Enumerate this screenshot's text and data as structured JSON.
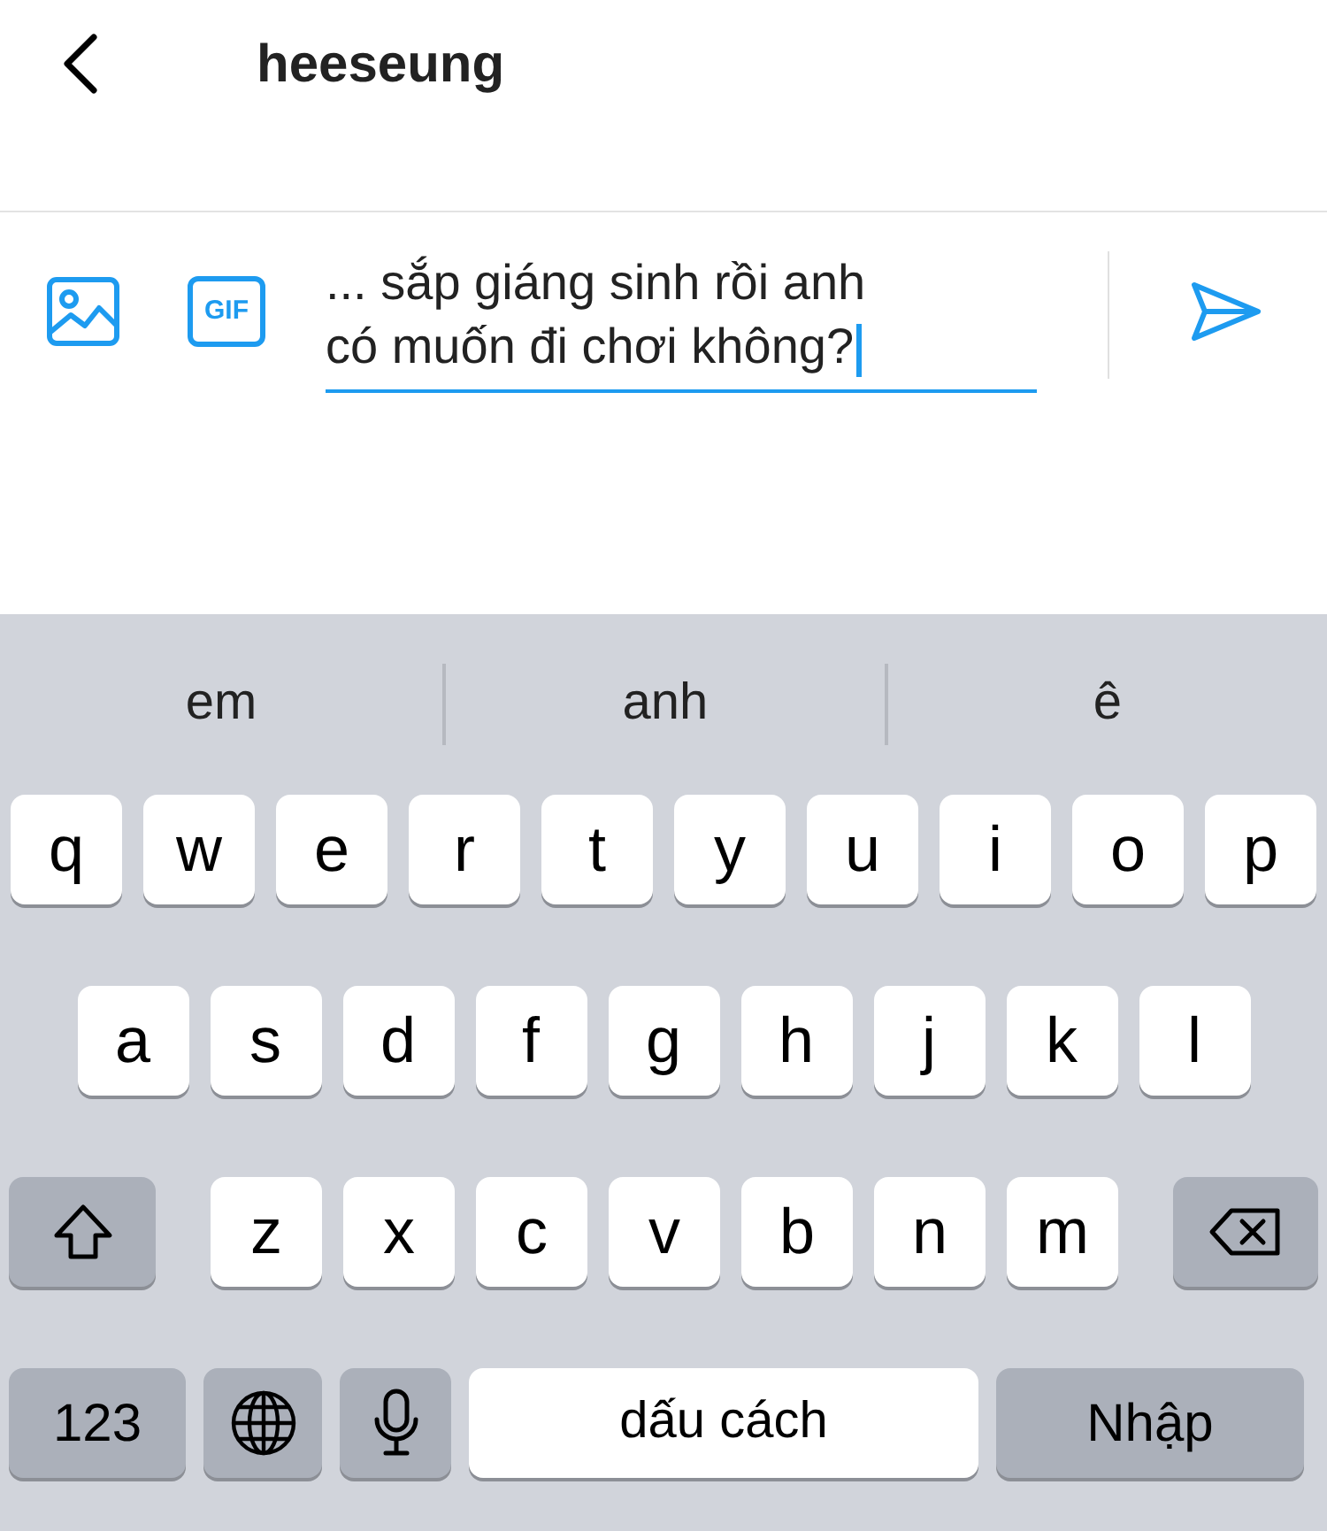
{
  "header": {
    "title": "heeseung"
  },
  "composer": {
    "gif_label": "GIF",
    "value_lines": [
      "... sắp giáng sinh rồi anh",
      "có muốn đi chơi không?"
    ]
  },
  "suggestions": [
    "em",
    "anh",
    "ê"
  ],
  "keyboard": {
    "rows": [
      {
        "keys": [
          {
            "kind": "letter",
            "label": "q"
          },
          {
            "kind": "letter",
            "label": "w"
          },
          {
            "kind": "letter",
            "label": "e"
          },
          {
            "kind": "letter",
            "label": "r"
          },
          {
            "kind": "letter",
            "label": "t"
          },
          {
            "kind": "letter",
            "label": "y"
          },
          {
            "kind": "letter",
            "label": "u"
          },
          {
            "kind": "letter",
            "label": "i"
          },
          {
            "kind": "letter",
            "label": "o"
          },
          {
            "kind": "letter",
            "label": "p"
          }
        ]
      },
      {
        "keys": [
          {
            "kind": "letter",
            "label": "a"
          },
          {
            "kind": "letter",
            "label": "s"
          },
          {
            "kind": "letter",
            "label": "d"
          },
          {
            "kind": "letter",
            "label": "f"
          },
          {
            "kind": "letter",
            "label": "g"
          },
          {
            "kind": "letter",
            "label": "h"
          },
          {
            "kind": "letter",
            "label": "j"
          },
          {
            "kind": "letter",
            "label": "k"
          },
          {
            "kind": "letter",
            "label": "l"
          }
        ]
      },
      {
        "keys": [
          {
            "kind": "shift"
          },
          {
            "kind": "letter",
            "label": "z"
          },
          {
            "kind": "letter",
            "label": "x"
          },
          {
            "kind": "letter",
            "label": "c"
          },
          {
            "kind": "letter",
            "label": "v"
          },
          {
            "kind": "letter",
            "label": "b"
          },
          {
            "kind": "letter",
            "label": "n"
          },
          {
            "kind": "letter",
            "label": "m"
          },
          {
            "kind": "backspace"
          }
        ]
      },
      {
        "keys": [
          {
            "kind": "numbers",
            "label": "123"
          },
          {
            "kind": "globe"
          },
          {
            "kind": "mic"
          },
          {
            "kind": "space",
            "label": "dấu cách"
          },
          {
            "kind": "return",
            "label": "Nhập"
          }
        ]
      }
    ]
  }
}
